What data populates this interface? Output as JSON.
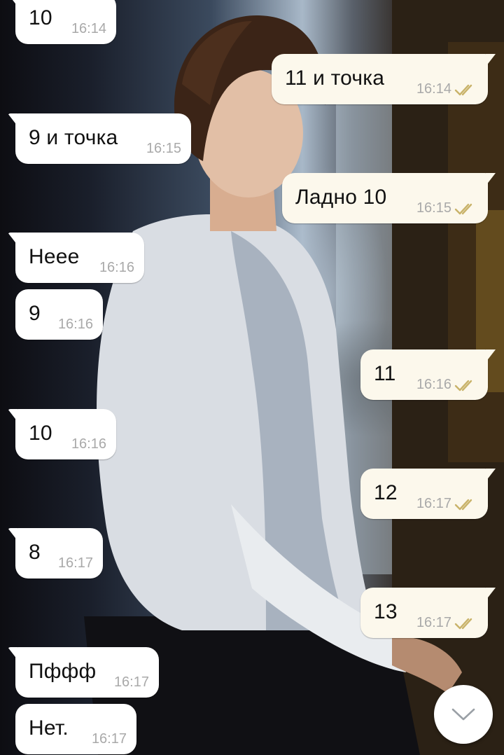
{
  "chat": {
    "messages": [
      {
        "direction": "in",
        "text": "10",
        "time": "16:14"
      },
      {
        "direction": "out",
        "text": "11 и точка",
        "time": "16:14",
        "read": true
      },
      {
        "direction": "in",
        "text": "9 и точка",
        "time": "16:15"
      },
      {
        "direction": "out",
        "text": "Ладно 10",
        "time": "16:15",
        "read": true
      },
      {
        "direction": "in",
        "text": "Неее",
        "time": "16:16"
      },
      {
        "direction": "in",
        "text": "9",
        "time": "16:16"
      },
      {
        "direction": "out",
        "text": "11",
        "time": "16:16",
        "read": true
      },
      {
        "direction": "in",
        "text": "10",
        "time": "16:16"
      },
      {
        "direction": "out",
        "text": "12",
        "time": "16:17",
        "read": true
      },
      {
        "direction": "in",
        "text": "8",
        "time": "16:17"
      },
      {
        "direction": "out",
        "text": "13",
        "time": "16:17",
        "read": true
      },
      {
        "direction": "in",
        "text": "Пффф",
        "time": "16:17"
      },
      {
        "direction": "in",
        "text": "Нет.",
        "time": "16:17"
      }
    ]
  },
  "icons": {
    "read_receipt": "double-check-icon",
    "scroll_down": "chevron-down-icon"
  },
  "colors": {
    "incoming_bubble": "#ffffff",
    "outgoing_bubble": "#fcf8ec",
    "read_tick": "#c9b36a",
    "time_text": "#a9a9a9",
    "message_text": "#111111"
  }
}
